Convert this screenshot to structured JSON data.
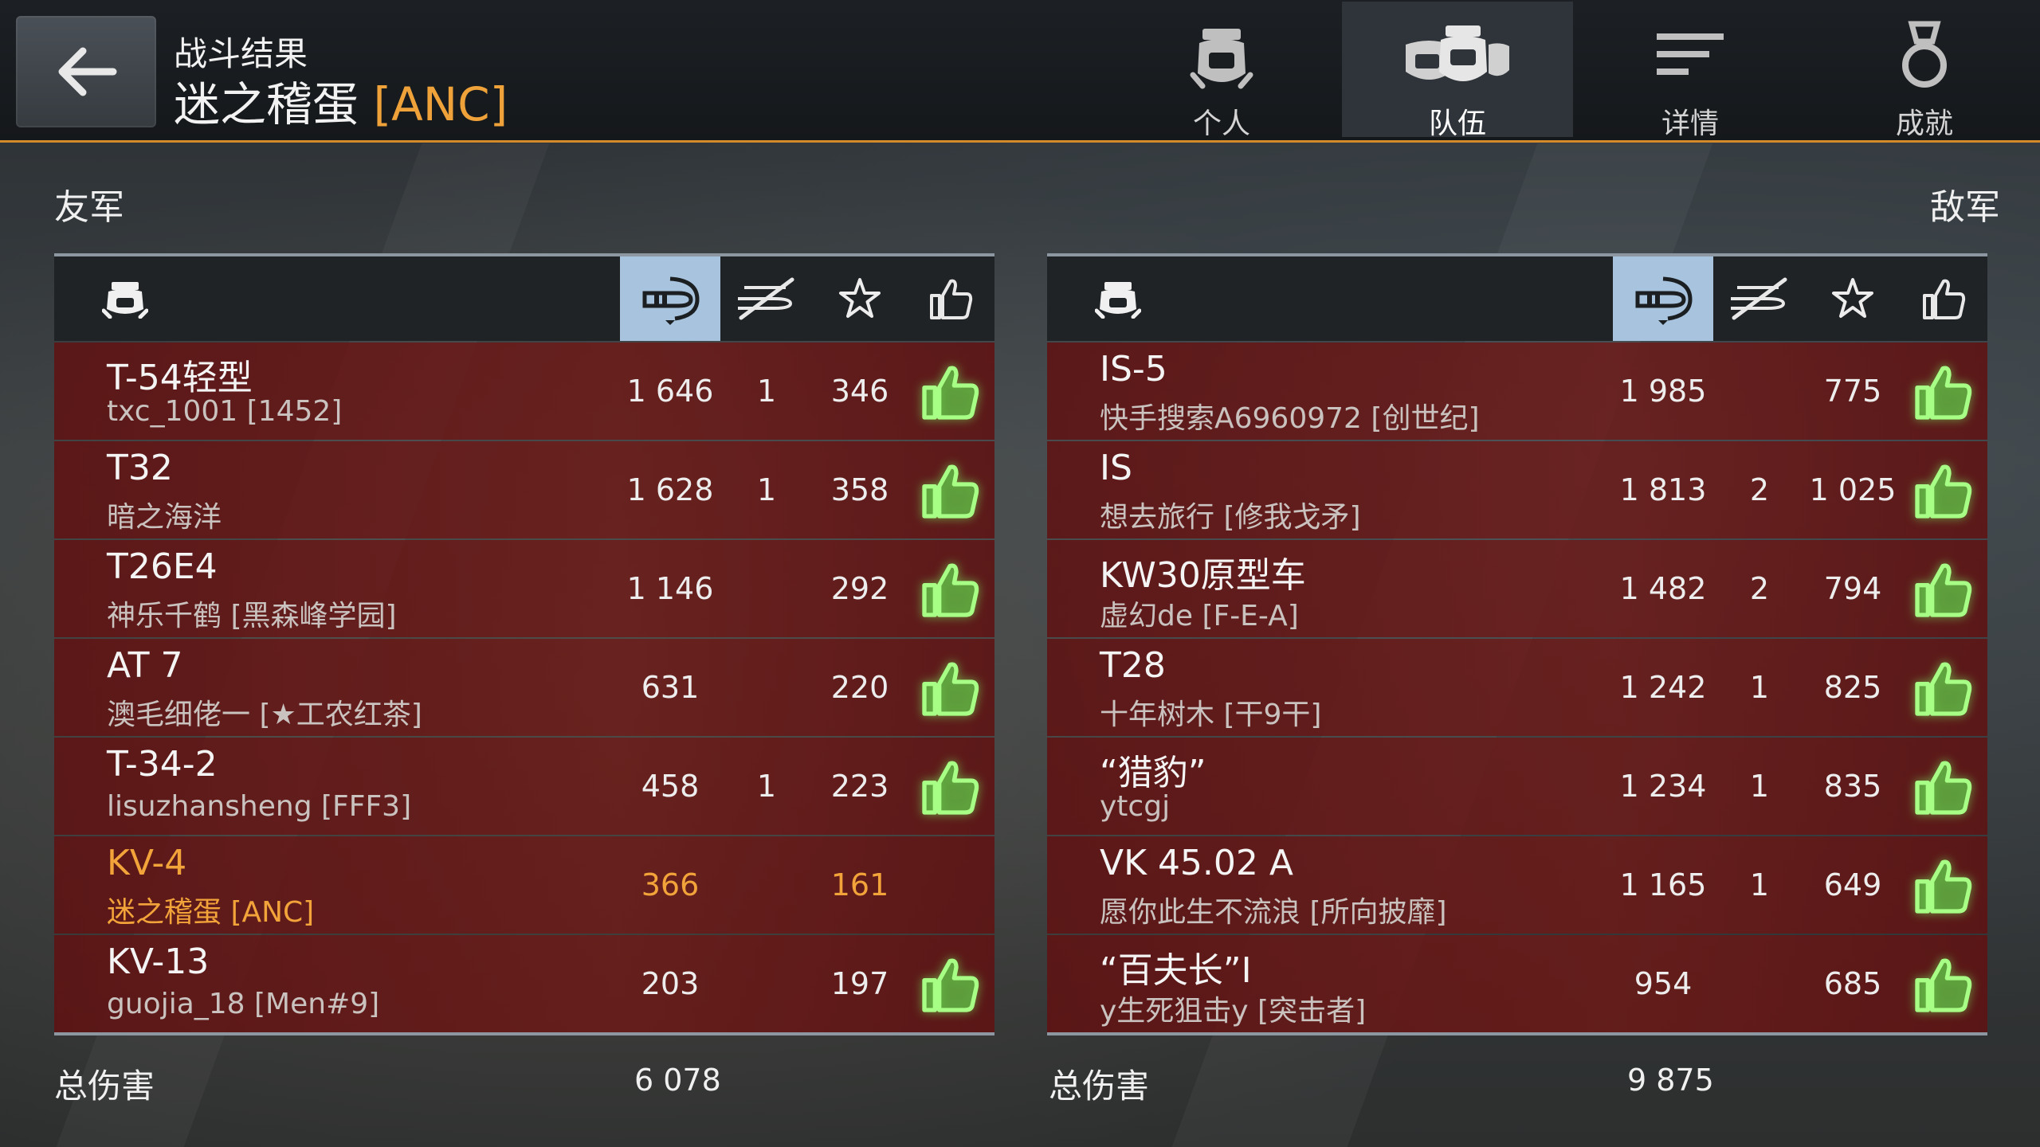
{
  "header": {
    "subtitle": "战斗结果",
    "player_name": "迷之稽蛋",
    "player_clan": "[ANC]",
    "tabs": [
      {
        "label": "个人",
        "icon": "single-helmet-icon",
        "active": false
      },
      {
        "label": "队伍",
        "icon": "team-helmets-icon",
        "active": true
      },
      {
        "label": "详情",
        "icon": "details-lines-icon",
        "active": false
      },
      {
        "label": "成就",
        "icon": "medal-icon",
        "active": false
      }
    ]
  },
  "allies": {
    "title": "友军",
    "total_label": "总伤害",
    "total_value": "6 078",
    "rows": [
      {
        "tank": "T-54轻型",
        "player": "txc_1001 [1452]",
        "damage": "1 646",
        "kills": "1",
        "xp": "346",
        "liked": true,
        "me": false
      },
      {
        "tank": "T32",
        "player": "暗之海洋",
        "damage": "1 628",
        "kills": "1",
        "xp": "358",
        "liked": true,
        "me": false
      },
      {
        "tank": "T26E4",
        "player": "神乐千鹤 [黑森峰学园]",
        "damage": "1 146",
        "kills": "",
        "xp": "292",
        "liked": true,
        "me": false
      },
      {
        "tank": "AT 7",
        "player": "澳毛细佬一 [★工农红茶]",
        "damage": "631",
        "kills": "",
        "xp": "220",
        "liked": true,
        "me": false
      },
      {
        "tank": "T-34-2",
        "player": "lisuzhansheng [FFF3]",
        "damage": "458",
        "kills": "1",
        "xp": "223",
        "liked": true,
        "me": false
      },
      {
        "tank": "KV-4",
        "player": "迷之稽蛋 [ANC]",
        "damage": "366",
        "kills": "",
        "xp": "161",
        "liked": false,
        "me": true
      },
      {
        "tank": "KV-13",
        "player": "guojia_18 [Men#9]",
        "damage": "203",
        "kills": "",
        "xp": "197",
        "liked": true,
        "me": false
      }
    ]
  },
  "enemies": {
    "title": "敌军",
    "total_label": "总伤害",
    "total_value": "9 875",
    "rows": [
      {
        "tank": "IS-5",
        "player": "快手搜索A6960972 [创世纪]",
        "damage": "1 985",
        "kills": "",
        "xp": "775",
        "liked": true,
        "me": false
      },
      {
        "tank": "IS",
        "player": "想去旅行 [修我戈矛]",
        "damage": "1 813",
        "kills": "2",
        "xp": "1 025",
        "liked": true,
        "me": false
      },
      {
        "tank": "KW30原型车",
        "player": "虚幻de [F-E-A]",
        "damage": "1 482",
        "kills": "2",
        "xp": "794",
        "liked": true,
        "me": false
      },
      {
        "tank": "T28",
        "player": "十年树木 [干9干]",
        "damage": "1 242",
        "kills": "1",
        "xp": "825",
        "liked": true,
        "me": false
      },
      {
        "tank": "“猎豹”",
        "player": "ytcgj",
        "damage": "1 234",
        "kills": "1",
        "xp": "835",
        "liked": true,
        "me": false
      },
      {
        "tank": "VK 45.02 A",
        "player": "愿你此生不流浪 [所向披靡]",
        "damage": "1 165",
        "kills": "1",
        "xp": "649",
        "liked": true,
        "me": false
      },
      {
        "tank": "“百夫长”I",
        "player": "y生死狙击y [突击者]",
        "damage": "954",
        "kills": "",
        "xp": "685",
        "liked": true,
        "me": false
      }
    ]
  },
  "columns": {
    "icons": [
      "tank-icon",
      "damage-shell-icon",
      "kills-crossed-icon",
      "star-icon",
      "thumbs-up-icon"
    ],
    "sorted_column": "damage",
    "colors": {
      "accent": "#f0a23a",
      "like": "#7ed957",
      "row": "#6b1a1a",
      "sorted_header": "#a8c3dd"
    }
  }
}
